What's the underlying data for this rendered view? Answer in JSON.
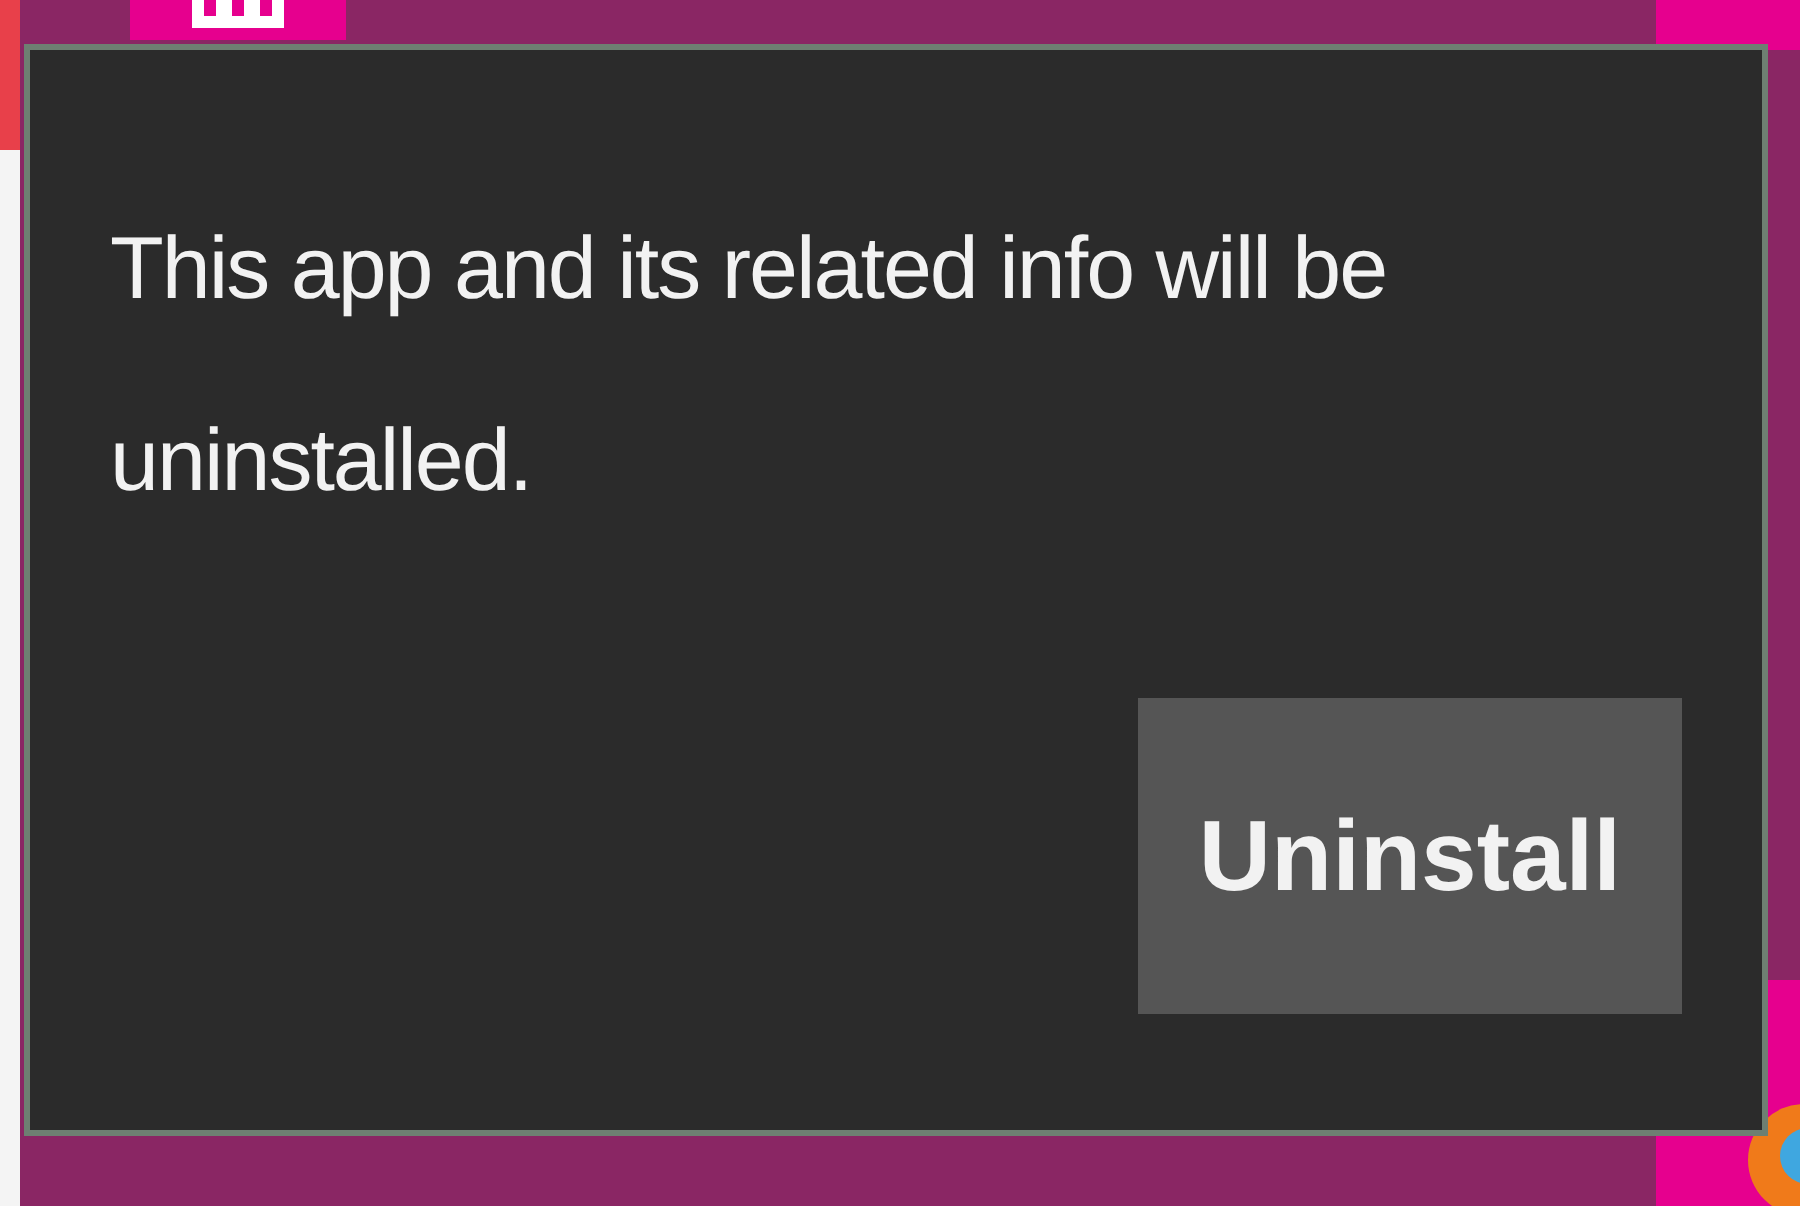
{
  "dialog": {
    "message": "This app and its related info will be uninstalled."
  },
  "buttons": [
    {
      "label": "Uninstall"
    }
  ]
}
